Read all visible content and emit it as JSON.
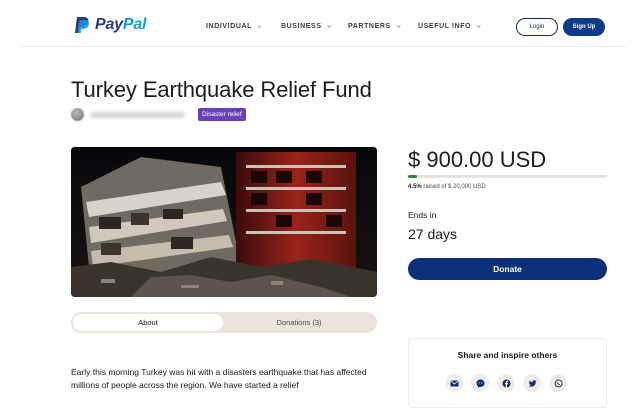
{
  "header": {
    "brand_pay": "Pay",
    "brand_pal": "Pal",
    "nav": [
      {
        "label": "INDIVIDUAL"
      },
      {
        "label": "BUSINESS"
      },
      {
        "label": "PARTNERS"
      },
      {
        "label": "USEFUL INFO"
      }
    ],
    "login_label": "Login",
    "signup_label": "Sign Up"
  },
  "campaign": {
    "title": "Turkey Earthquake Relief Fund",
    "badge": "Disaster relief",
    "description": "Early this morning Turkey was hit with a disasters earthquake that has affected millions of people across the region. We have started a relief"
  },
  "tabs": {
    "about": "About",
    "donations": "Donations (3)"
  },
  "funding": {
    "amount": "$ 900.00 USD",
    "percent_label": "4.5%",
    "percent_value": 4.5,
    "raised_text": "raised of $ 20,000 USD",
    "ends_label": "Ends in",
    "ends_value": "27 days",
    "donate_label": "Donate"
  },
  "share": {
    "title": "Share and inspire others",
    "icons": [
      "email-icon",
      "messenger-icon",
      "facebook-icon",
      "twitter-icon",
      "whatsapp-icon"
    ]
  },
  "colors": {
    "primary": "#0c2f7a",
    "badge": "#6b3fb9",
    "progress": "#2a8a3d"
  }
}
